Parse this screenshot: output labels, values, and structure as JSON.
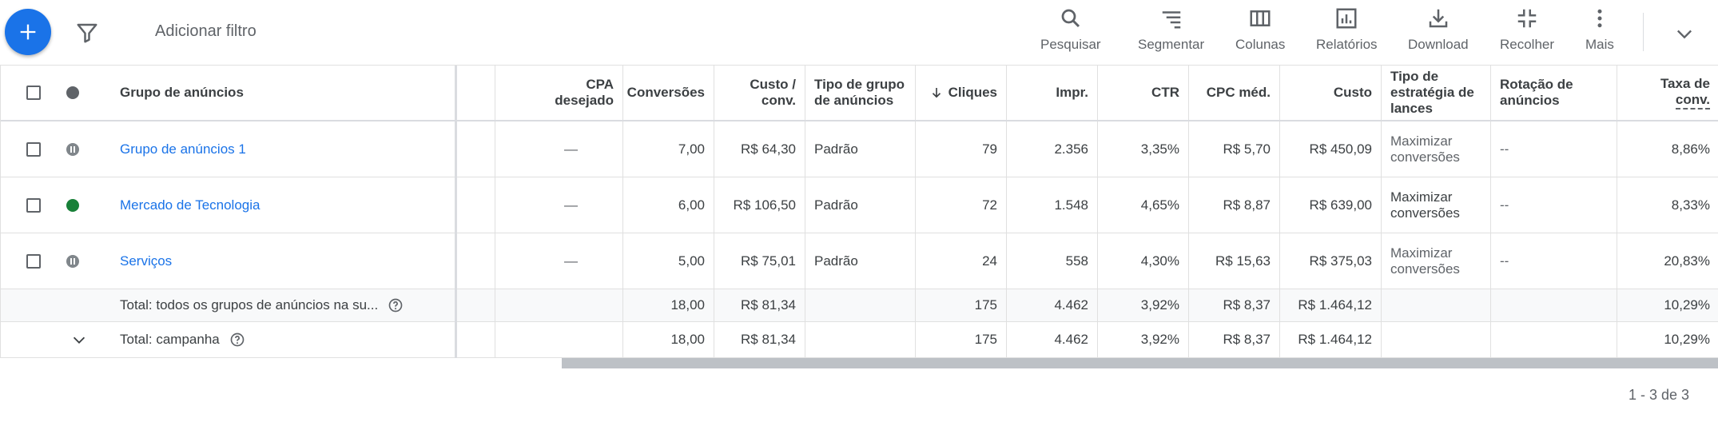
{
  "toolbar": {
    "add_filter": "Adicionar filtro",
    "tools": [
      {
        "label": "Pesquisar",
        "icon": "search-icon"
      },
      {
        "label": "Segmentar",
        "icon": "segment-icon"
      },
      {
        "label": "Colunas",
        "icon": "columns-icon"
      },
      {
        "label": "Relatórios",
        "icon": "reports-icon"
      },
      {
        "label": "Download",
        "icon": "download-icon"
      },
      {
        "label": "Recolher",
        "icon": "collapse-icon"
      },
      {
        "label": "Mais",
        "icon": "more-vert-icon"
      }
    ]
  },
  "table": {
    "headers": {
      "ad_group": "Grupo de anúncios",
      "target_cpa_1": "CPA",
      "target_cpa_2": "desejado",
      "conversions": "Conversões",
      "cost_conv_1": "Custo /",
      "cost_conv_2": "conv.",
      "group_type_1": "Tipo de grupo",
      "group_type_2": "de anúncios",
      "clicks": "Cliques",
      "impr": "Impr.",
      "ctr": "CTR",
      "avg_cpc": "CPC méd.",
      "cost": "Custo",
      "bid_strategy_1": "Tipo de",
      "bid_strategy_2": "estratégia de",
      "bid_strategy_3": "lances",
      "rotation_1": "Rotação de",
      "rotation_2": "anúncios",
      "conv_rate_1": "Taxa de",
      "conv_rate_2": "conv."
    },
    "rows": [
      {
        "name": "Grupo de anúncios 1",
        "status": "paused",
        "target_cpa": "—",
        "conversions": "7,00",
        "cost_conv": "R$ 64,30",
        "group_type": "Padrão",
        "clicks": "79",
        "impr": "2.356",
        "ctr": "3,35%",
        "avg_cpc": "R$ 5,70",
        "cost": "R$ 450,09",
        "bid_1": "Maximizar",
        "bid_2": "conversões",
        "rotation": "--",
        "conv_rate": "8,86%"
      },
      {
        "name": "Mercado de Tecnologia",
        "status": "enabled",
        "target_cpa": "—",
        "conversions": "6,00",
        "cost_conv": "R$ 106,50",
        "group_type": "Padrão",
        "clicks": "72",
        "impr": "1.548",
        "ctr": "4,65%",
        "avg_cpc": "R$ 8,87",
        "cost": "R$ 639,00",
        "bid_1": "Maximizar",
        "bid_2": "conversões",
        "rotation": "--",
        "conv_rate": "8,33%"
      },
      {
        "name": "Serviços",
        "status": "paused",
        "target_cpa": "—",
        "conversions": "5,00",
        "cost_conv": "R$ 75,01",
        "group_type": "Padrão",
        "clicks": "24",
        "impr": "558",
        "ctr": "4,30%",
        "avg_cpc": "R$ 15,63",
        "cost": "R$ 375,03",
        "bid_1": "Maximizar",
        "bid_2": "conversões",
        "rotation": "--",
        "conv_rate": "20,83%"
      }
    ],
    "totals": [
      {
        "label": "Total: todos os grupos de anúncios na su...",
        "conversions": "18,00",
        "cost_conv": "R$ 81,34",
        "clicks": "175",
        "impr": "4.462",
        "ctr": "3,92%",
        "avg_cpc": "R$ 8,37",
        "cost": "R$ 1.464,12",
        "conv_rate": "10,29%"
      },
      {
        "label": "Total: campanha",
        "conversions": "18,00",
        "cost_conv": "R$ 81,34",
        "clicks": "175",
        "impr": "4.462",
        "ctr": "3,92%",
        "avg_cpc": "R$ 8,37",
        "cost": "R$ 1.464,12",
        "conv_rate": "10,29%"
      }
    ]
  },
  "pager": {
    "text": "1 - 3 de 3"
  },
  "colors": {
    "accent": "#1a73e8",
    "enabled": "#188038",
    "paused": "#80868b"
  }
}
